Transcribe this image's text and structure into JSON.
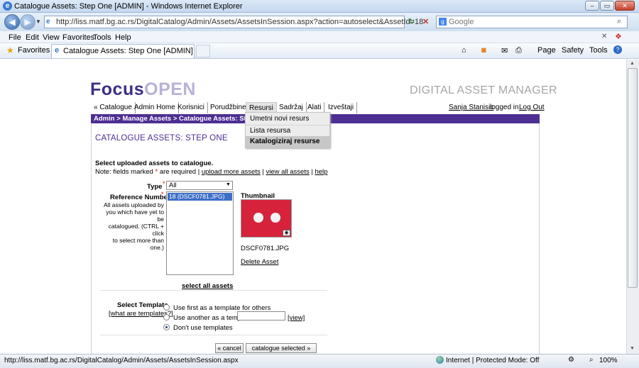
{
  "window": {
    "title": "Catalogue Assets: Step One [ADMIN] - Windows Internet Explorer"
  },
  "address": {
    "url": "http://liss.matf.bg.ac.rs/DigitalCatalog/Admin/Assets/AssetsInSession.aspx?action=autoselect&AssetId=18",
    "search_placeholder": "Google"
  },
  "menu": [
    "File",
    "Edit",
    "View",
    "Favorites",
    "Tools",
    "Help"
  ],
  "favorites": {
    "label": "Favorites",
    "tab": "Catalogue Assets: Step One [ADMIN]"
  },
  "commandbar": {
    "page": "Page",
    "safety": "Safety",
    "tools": "Tools"
  },
  "site": {
    "logo_focus": "Focus",
    "logo_open": "OPEN",
    "tagline": "DIGITAL ASSET MANAGER",
    "nav": [
      "« Catalogue",
      "Admin Home",
      "Korisnici",
      "Porudžbine",
      "Resursi",
      "Sadržaj",
      "Alati",
      "Izveštaji"
    ],
    "user": "Sanja Stanisic",
    "logged_in": "logged in",
    "logout": "Log Out",
    "dropdown": [
      "Umetni novi resurs",
      "Lista resursa",
      "Katalogiziraj resurse"
    ],
    "breadcrumb": "Admin > Manage Assets > Catalogue Assets: Step One"
  },
  "page": {
    "heading": "CATALOGUE ASSETS: STEP ONE",
    "instruction": "Select uploaded assets to catalogue.",
    "note_prefix": "Note: fields marked",
    "note_star": "*",
    "note_suffix": "are required |",
    "upload_more": "upload more assets",
    "view_all": "view all assets",
    "help": "help",
    "sep": "|",
    "type_label": "Type",
    "type_value": "All",
    "ref_label": "Reference Number",
    "ref_help": [
      "All assets uploaded by",
      "you which have yet to be",
      "catalogued. (CTRL + click",
      "to select more than one.)"
    ],
    "ref_item": "18 (DSCF0781.JPG)",
    "thumb_label": "Thumbnail",
    "filename": "DSCF0781.JPG",
    "delete": "Delete Asset",
    "select_all": "select all assets",
    "template_label": "Select Template",
    "what_templates": "[what are templates?]",
    "opt1": "Use first as a template for others",
    "opt2": "Use another as a template:",
    "view_link": "[view]",
    "opt3": "Don't use templates",
    "cancel": "« cancel",
    "catalogue": "catalogue selected »"
  },
  "status": {
    "text": "http://liss.matf.bg.ac.rs/DigitalCatalog/Admin/Assets/AssetsInSession.aspx",
    "zone": "Internet | Protected Mode: Off",
    "zoom": "100%"
  }
}
